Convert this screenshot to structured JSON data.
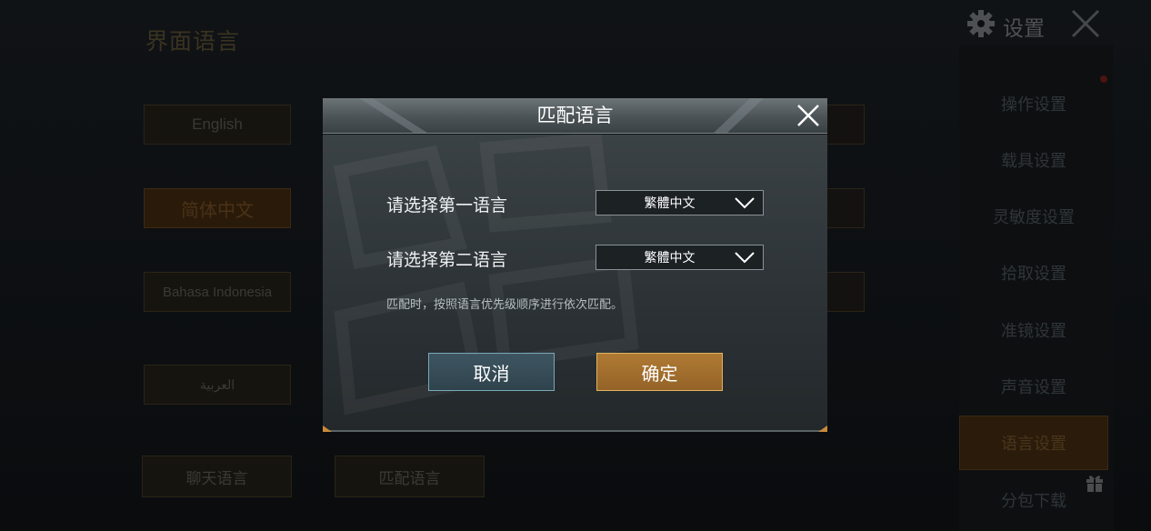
{
  "background": {
    "title": "界面语言",
    "language_buttons": [
      "English",
      "简体中文",
      "Bahasa Indonesia",
      "العربية"
    ],
    "bottom_buttons": [
      "聊天语言",
      "匹配语言"
    ]
  },
  "header": {
    "settings_label": "设置",
    "gear_icon": "gear-icon",
    "close_icon": "close-icon"
  },
  "sidebar": {
    "items": [
      "操作设置",
      "载具设置",
      "灵敏度设置",
      "拾取设置",
      "准镜设置",
      "声音设置",
      "语言设置",
      "分包下载"
    ],
    "active_index": 6
  },
  "modal": {
    "title": "匹配语言",
    "first_label": "请选择第一语言",
    "first_value": "繁體中文",
    "second_label": "请选择第二语言",
    "second_value": "繁體中文",
    "note": "匹配时，按照语言优先级顺序进行依次匹配。",
    "cancel_label": "取消",
    "ok_label": "确定"
  },
  "colors": {
    "accent_orange": "#b07a34",
    "cancel_teal": "#3e5561"
  }
}
